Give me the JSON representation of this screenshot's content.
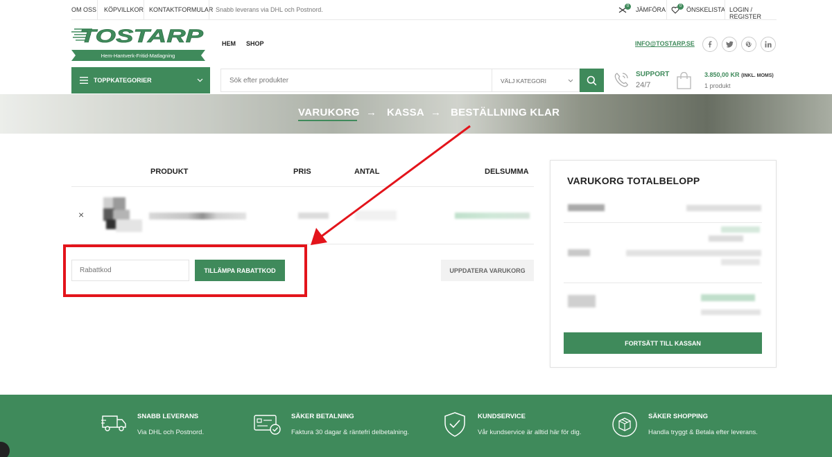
{
  "topbar": {
    "links": [
      "OM OSS",
      "KÖPVILLKOR",
      "KONTAKTFORMULAR"
    ],
    "note": "Snabb leverans via DHL och Postnord.",
    "compare_label": "JÄMFÖRA",
    "compare_count": "0",
    "wishlist_label": "ÖNSKELISTA",
    "wishlist_count": "0",
    "login_label": "LOGIN / REGISTER"
  },
  "brand": {
    "logo_text": "TOSTARP",
    "tagline": "Hem-Hantverk-Fritid-Matlagning",
    "color": "#3f8a5b"
  },
  "nav": {
    "items": [
      "HEM",
      "SHOP"
    ]
  },
  "header": {
    "email": "INFO@TOSTARP.SE",
    "social_icons": [
      "facebook-icon",
      "twitter-icon",
      "pinterest-icon",
      "linkedin-icon"
    ]
  },
  "categories": {
    "label": "TOPPKATEGORIER"
  },
  "search": {
    "placeholder": "Sök efter produkter",
    "category_label": "VÄLJ KATEGORI"
  },
  "support": {
    "title": "SUPPORT",
    "hours": "24/7"
  },
  "cart_summary": {
    "amount": "3.850,00 kr",
    "tax_note": "(INKL. MOMS)",
    "count": "1 produkt"
  },
  "steps": {
    "items": [
      "VARUKORG",
      "KASSA",
      "BESTÄLLNING KLAR"
    ],
    "arrow": "→",
    "active_index": 0
  },
  "cart": {
    "headers": {
      "product": "PRODUKT",
      "price": "PRIS",
      "quantity": "ANTAL",
      "subtotal": "DELSUMMA"
    },
    "remove_symbol": "×",
    "coupon_placeholder": "Rabattkod",
    "apply_label": "TILLÄMPA RABATTKOD",
    "update_label": "UPPDATERA VARUKORG"
  },
  "totals": {
    "title": "VARUKORG TOTALBELOPP",
    "checkout_label": "FORTSÄTT TILL KASSAN"
  },
  "footer": {
    "features": [
      {
        "icon": "truck-icon",
        "title": "SNABB LEVERANS",
        "text": "Via DHL och Postnord."
      },
      {
        "icon": "card-check-icon",
        "title": "SÄKER BETALNING",
        "text": "Faktura 30 dagar & räntefri delbetalning."
      },
      {
        "icon": "shield-check-icon",
        "title": "KUNDSERVICE",
        "text": "Vår kundservice är alltid här för dig."
      },
      {
        "icon": "secure-box-icon",
        "title": "SÄKER SHOPPING",
        "text": "Handla tryggt & Betala efter leverans."
      }
    ]
  },
  "annotation": {
    "color": "#e3141b"
  }
}
